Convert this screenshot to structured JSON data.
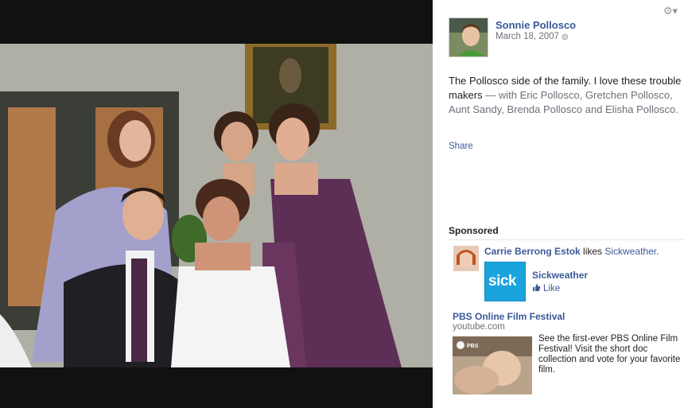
{
  "post": {
    "author": "Sonnie Pollosco",
    "date": "March 18, 2007",
    "caption_text": "The Pollosco side of the family. I love these trouble makers",
    "caption_tags": " — with Eric Pollosco, Gretchen Pollosco, Aunt Sandy, Brenda Pollosco and Elisha Pollosco.",
    "share_label": "Share"
  },
  "sponsored": {
    "title": "Sponsored",
    "liker_name": "Carrie Berrong Estok",
    "liker_verb": " likes ",
    "liked_page": "Sickweather",
    "page_logo_text": "sick",
    "page_name": "Sickweather",
    "like_label": "Like"
  },
  "ad": {
    "title": "PBS Online Film Festival",
    "url": "youtube.com",
    "body": "See the first-ever PBS Online Film Festival! Visit the short doc collection and vote for your favorite film.",
    "thumb_text": "PBS"
  },
  "colors": {
    "link": "#3b5998",
    "brand_sick": "#1aa3dd",
    "viewer_bg": "#111111"
  },
  "icons": {
    "settings": "gear-icon",
    "privacy": "globe-icon",
    "like": "thumbs-up-icon"
  }
}
